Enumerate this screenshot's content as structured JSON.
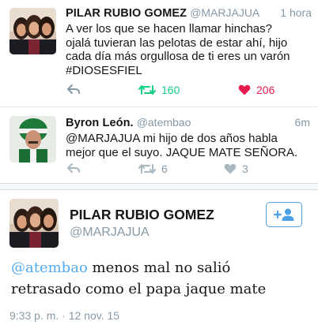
{
  "tweet1": {
    "name": "PILAR RUBIO GOMEZ",
    "handle": "@MARJAJUA",
    "time": "1 hora",
    "lines": [
      "A ver los que se hacen llamar hinchas?",
      "ojalá tuvieran las pelotas de estar ahí, hijo",
      "cada día más orgullosa de ti eres un varón",
      "#DIOSESFIEL"
    ],
    "retweets": "160",
    "likes": "206"
  },
  "tweet2": {
    "name": "Byron León.",
    "handle": "@atembao",
    "time": "6m",
    "lines": [
      "@MARJAJUA mi hijo de dos años habla",
      "mejor que el suyo. JAQUE MATE SEÑORA."
    ],
    "retweets": "6",
    "likes": "3"
  },
  "detail": {
    "name": "PILAR RUBIO GOMEZ",
    "handle": "@MARJAJUA",
    "mention": "@atembao",
    "line1_rest": " menos mal no salió",
    "line2": "retrasado como el papa jaque mate",
    "timestamp": "9:33 p. m. · 12 nov. 15"
  },
  "icons": {
    "reply": "reply-icon",
    "retweet": "retweet-icon",
    "like": "heart-icon",
    "follow": "follow-user-icon"
  },
  "colors": {
    "retweet_green": "#19cf86",
    "like_red": "#e81c4f",
    "link_blue": "#55acee",
    "muted": "#8899a6"
  }
}
